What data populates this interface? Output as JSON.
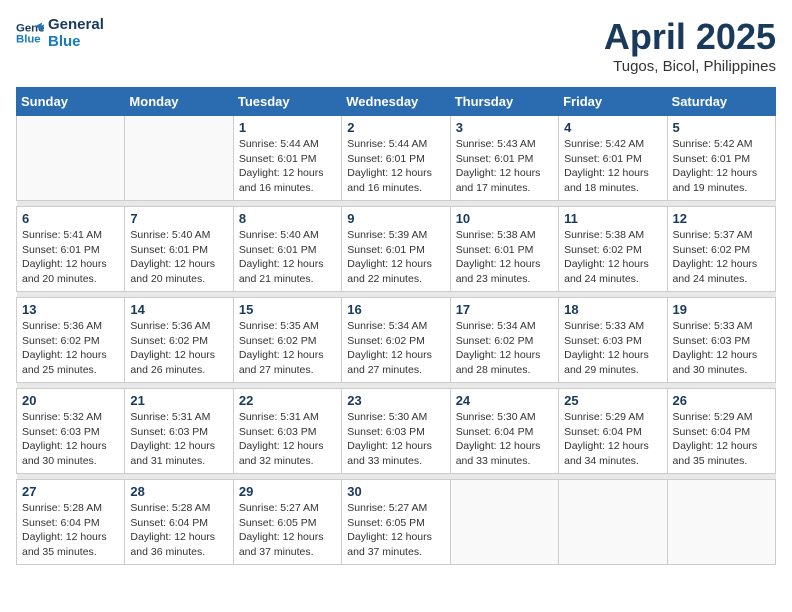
{
  "logo": {
    "line1": "General",
    "line2": "Blue"
  },
  "title": "April 2025",
  "subtitle": "Tugos, Bicol, Philippines",
  "days_of_week": [
    "Sunday",
    "Monday",
    "Tuesday",
    "Wednesday",
    "Thursday",
    "Friday",
    "Saturday"
  ],
  "weeks": [
    [
      {
        "day": "",
        "sunrise": "",
        "sunset": "",
        "daylight": ""
      },
      {
        "day": "",
        "sunrise": "",
        "sunset": "",
        "daylight": ""
      },
      {
        "day": "1",
        "sunrise": "Sunrise: 5:44 AM",
        "sunset": "Sunset: 6:01 PM",
        "daylight": "Daylight: 12 hours and 16 minutes."
      },
      {
        "day": "2",
        "sunrise": "Sunrise: 5:44 AM",
        "sunset": "Sunset: 6:01 PM",
        "daylight": "Daylight: 12 hours and 16 minutes."
      },
      {
        "day": "3",
        "sunrise": "Sunrise: 5:43 AM",
        "sunset": "Sunset: 6:01 PM",
        "daylight": "Daylight: 12 hours and 17 minutes."
      },
      {
        "day": "4",
        "sunrise": "Sunrise: 5:42 AM",
        "sunset": "Sunset: 6:01 PM",
        "daylight": "Daylight: 12 hours and 18 minutes."
      },
      {
        "day": "5",
        "sunrise": "Sunrise: 5:42 AM",
        "sunset": "Sunset: 6:01 PM",
        "daylight": "Daylight: 12 hours and 19 minutes."
      }
    ],
    [
      {
        "day": "6",
        "sunrise": "Sunrise: 5:41 AM",
        "sunset": "Sunset: 6:01 PM",
        "daylight": "Daylight: 12 hours and 20 minutes."
      },
      {
        "day": "7",
        "sunrise": "Sunrise: 5:40 AM",
        "sunset": "Sunset: 6:01 PM",
        "daylight": "Daylight: 12 hours and 20 minutes."
      },
      {
        "day": "8",
        "sunrise": "Sunrise: 5:40 AM",
        "sunset": "Sunset: 6:01 PM",
        "daylight": "Daylight: 12 hours and 21 minutes."
      },
      {
        "day": "9",
        "sunrise": "Sunrise: 5:39 AM",
        "sunset": "Sunset: 6:01 PM",
        "daylight": "Daylight: 12 hours and 22 minutes."
      },
      {
        "day": "10",
        "sunrise": "Sunrise: 5:38 AM",
        "sunset": "Sunset: 6:01 PM",
        "daylight": "Daylight: 12 hours and 23 minutes."
      },
      {
        "day": "11",
        "sunrise": "Sunrise: 5:38 AM",
        "sunset": "Sunset: 6:02 PM",
        "daylight": "Daylight: 12 hours and 24 minutes."
      },
      {
        "day": "12",
        "sunrise": "Sunrise: 5:37 AM",
        "sunset": "Sunset: 6:02 PM",
        "daylight": "Daylight: 12 hours and 24 minutes."
      }
    ],
    [
      {
        "day": "13",
        "sunrise": "Sunrise: 5:36 AM",
        "sunset": "Sunset: 6:02 PM",
        "daylight": "Daylight: 12 hours and 25 minutes."
      },
      {
        "day": "14",
        "sunrise": "Sunrise: 5:36 AM",
        "sunset": "Sunset: 6:02 PM",
        "daylight": "Daylight: 12 hours and 26 minutes."
      },
      {
        "day": "15",
        "sunrise": "Sunrise: 5:35 AM",
        "sunset": "Sunset: 6:02 PM",
        "daylight": "Daylight: 12 hours and 27 minutes."
      },
      {
        "day": "16",
        "sunrise": "Sunrise: 5:34 AM",
        "sunset": "Sunset: 6:02 PM",
        "daylight": "Daylight: 12 hours and 27 minutes."
      },
      {
        "day": "17",
        "sunrise": "Sunrise: 5:34 AM",
        "sunset": "Sunset: 6:02 PM",
        "daylight": "Daylight: 12 hours and 28 minutes."
      },
      {
        "day": "18",
        "sunrise": "Sunrise: 5:33 AM",
        "sunset": "Sunset: 6:03 PM",
        "daylight": "Daylight: 12 hours and 29 minutes."
      },
      {
        "day": "19",
        "sunrise": "Sunrise: 5:33 AM",
        "sunset": "Sunset: 6:03 PM",
        "daylight": "Daylight: 12 hours and 30 minutes."
      }
    ],
    [
      {
        "day": "20",
        "sunrise": "Sunrise: 5:32 AM",
        "sunset": "Sunset: 6:03 PM",
        "daylight": "Daylight: 12 hours and 30 minutes."
      },
      {
        "day": "21",
        "sunrise": "Sunrise: 5:31 AM",
        "sunset": "Sunset: 6:03 PM",
        "daylight": "Daylight: 12 hours and 31 minutes."
      },
      {
        "day": "22",
        "sunrise": "Sunrise: 5:31 AM",
        "sunset": "Sunset: 6:03 PM",
        "daylight": "Daylight: 12 hours and 32 minutes."
      },
      {
        "day": "23",
        "sunrise": "Sunrise: 5:30 AM",
        "sunset": "Sunset: 6:03 PM",
        "daylight": "Daylight: 12 hours and 33 minutes."
      },
      {
        "day": "24",
        "sunrise": "Sunrise: 5:30 AM",
        "sunset": "Sunset: 6:04 PM",
        "daylight": "Daylight: 12 hours and 33 minutes."
      },
      {
        "day": "25",
        "sunrise": "Sunrise: 5:29 AM",
        "sunset": "Sunset: 6:04 PM",
        "daylight": "Daylight: 12 hours and 34 minutes."
      },
      {
        "day": "26",
        "sunrise": "Sunrise: 5:29 AM",
        "sunset": "Sunset: 6:04 PM",
        "daylight": "Daylight: 12 hours and 35 minutes."
      }
    ],
    [
      {
        "day": "27",
        "sunrise": "Sunrise: 5:28 AM",
        "sunset": "Sunset: 6:04 PM",
        "daylight": "Daylight: 12 hours and 35 minutes."
      },
      {
        "day": "28",
        "sunrise": "Sunrise: 5:28 AM",
        "sunset": "Sunset: 6:04 PM",
        "daylight": "Daylight: 12 hours and 36 minutes."
      },
      {
        "day": "29",
        "sunrise": "Sunrise: 5:27 AM",
        "sunset": "Sunset: 6:05 PM",
        "daylight": "Daylight: 12 hours and 37 minutes."
      },
      {
        "day": "30",
        "sunrise": "Sunrise: 5:27 AM",
        "sunset": "Sunset: 6:05 PM",
        "daylight": "Daylight: 12 hours and 37 minutes."
      },
      {
        "day": "",
        "sunrise": "",
        "sunset": "",
        "daylight": ""
      },
      {
        "day": "",
        "sunrise": "",
        "sunset": "",
        "daylight": ""
      },
      {
        "day": "",
        "sunrise": "",
        "sunset": "",
        "daylight": ""
      }
    ]
  ]
}
